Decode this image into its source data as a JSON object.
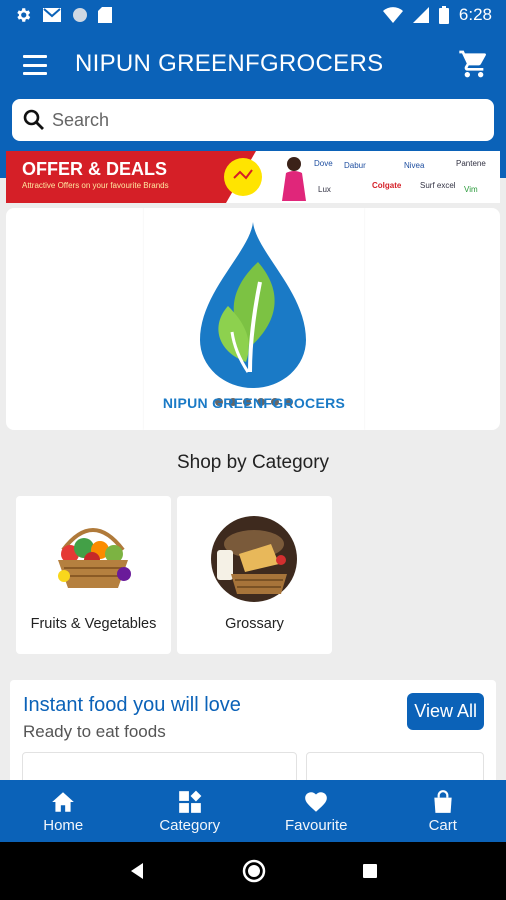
{
  "status_bar": {
    "time": "6:28"
  },
  "app_bar": {
    "title": "NIPUN GREENFGROCERS"
  },
  "search": {
    "placeholder": "Search"
  },
  "offer_banner": {
    "title": "OFFER & DEALS",
    "subtitle": "Attractive Offers on your favourite Brands",
    "brands": [
      "Dove",
      "Dabur",
      "Nivea",
      "Lux",
      "Colgate",
      "Pantene",
      "Surf excel",
      "Vim"
    ]
  },
  "hero": {
    "brand_text": "NIPUN GREENFGROCERS",
    "slide_count": 6
  },
  "categories": {
    "title": "Shop by Category",
    "items": [
      {
        "label": "Fruits & Vegetables",
        "icon": "fruit-basket-image"
      },
      {
        "label": "Grossary",
        "icon": "bread-basket-image"
      }
    ]
  },
  "instant_food": {
    "title": "Instant food you will love",
    "subtitle": "Ready to eat foods",
    "view_all_label": "View All"
  },
  "bottom_nav": {
    "items": [
      {
        "label": "Home",
        "icon": "home-icon"
      },
      {
        "label": "Category",
        "icon": "category-icon"
      },
      {
        "label": "Favourite",
        "icon": "heart-icon"
      },
      {
        "label": "Cart",
        "icon": "bag-icon"
      }
    ]
  },
  "colors": {
    "primary": "#0b62b8",
    "offer_red": "#d51f27",
    "leaf_green": "#7cc243",
    "drop_blue": "#1a7ac6"
  }
}
